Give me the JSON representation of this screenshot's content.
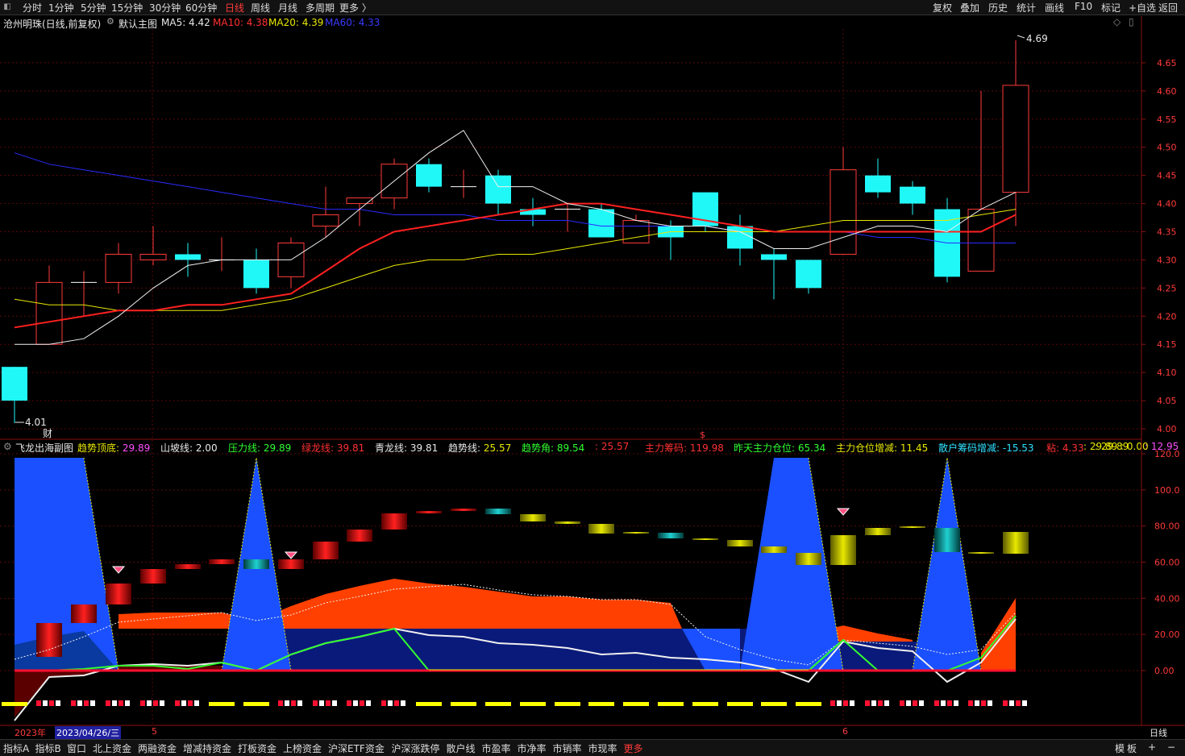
{
  "topbar": {
    "timeframes": [
      "分时",
      "1分钟",
      "5分钟",
      "15分钟",
      "30分钟",
      "60分钟",
      "日线",
      "周线",
      "月线",
      "多周期",
      "更多 〉"
    ],
    "active_timeframe": "日线",
    "tools": [
      "复权",
      "叠加",
      "历史",
      "统计",
      "画线",
      "F10",
      "标记",
      "+自选",
      "返回"
    ]
  },
  "main_chart": {
    "stock": "沧州明珠(日线,前复权)",
    "template": "默认主图",
    "ma_labels": [
      {
        "text": "MA5: 4.42",
        "color": "#e8e8e8"
      },
      {
        "text": "MA10: 4.38",
        "color": "#ff3030"
      },
      {
        "text": "MA20: 4.39",
        "color": "#e8e800"
      },
      {
        "text": "MA60: 4.33",
        "color": "#3a3aff"
      }
    ],
    "y_axis": [
      "4.65",
      "4.60",
      "4.55",
      "4.50",
      "4.45",
      "4.40",
      "4.35",
      "4.30",
      "4.25",
      "4.20",
      "4.15",
      "4.10",
      "4.05",
      "4.00"
    ],
    "high_label": "4.69",
    "low_label": "4.01",
    "marker_cai": "财",
    "marker_s": "$"
  },
  "chart_data": {
    "type": "candlestick",
    "ylim": [
      3.98,
      4.71
    ],
    "candles": [
      {
        "o": 4.11,
        "h": 4.11,
        "l": 4.01,
        "c": 4.05
      },
      {
        "o": 4.15,
        "h": 4.29,
        "l": 4.15,
        "c": 4.26
      },
      {
        "o": 4.26,
        "h": 4.28,
        "l": 4.2,
        "c": 4.26
      },
      {
        "o": 4.26,
        "h": 4.33,
        "l": 4.24,
        "c": 4.31
      },
      {
        "o": 4.3,
        "h": 4.36,
        "l": 4.29,
        "c": 4.31
      },
      {
        "o": 4.31,
        "h": 4.33,
        "l": 4.27,
        "c": 4.3
      },
      {
        "o": 4.3,
        "h": 4.34,
        "l": 4.28,
        "c": 4.3
      },
      {
        "o": 4.3,
        "h": 4.32,
        "l": 4.24,
        "c": 4.25
      },
      {
        "o": 4.27,
        "h": 4.34,
        "l": 4.25,
        "c": 4.33
      },
      {
        "o": 4.36,
        "h": 4.43,
        "l": 4.34,
        "c": 4.38
      },
      {
        "o": 4.4,
        "h": 4.41,
        "l": 4.36,
        "c": 4.41
      },
      {
        "o": 4.41,
        "h": 4.48,
        "l": 4.39,
        "c": 4.47
      },
      {
        "o": 4.47,
        "h": 4.48,
        "l": 4.42,
        "c": 4.43
      },
      {
        "o": 4.43,
        "h": 4.46,
        "l": 4.41,
        "c": 4.43
      },
      {
        "o": 4.45,
        "h": 4.46,
        "l": 4.38,
        "c": 4.4
      },
      {
        "o": 4.39,
        "h": 4.41,
        "l": 4.36,
        "c": 4.38
      },
      {
        "o": 4.39,
        "h": 4.4,
        "l": 4.35,
        "c": 4.39
      },
      {
        "o": 4.39,
        "h": 4.4,
        "l": 4.34,
        "c": 4.34
      },
      {
        "o": 4.33,
        "h": 4.38,
        "l": 4.33,
        "c": 4.37
      },
      {
        "o": 4.36,
        "h": 4.37,
        "l": 4.3,
        "c": 4.34
      },
      {
        "o": 4.42,
        "h": 4.42,
        "l": 4.35,
        "c": 4.36
      },
      {
        "o": 4.36,
        "h": 4.38,
        "l": 4.29,
        "c": 4.32
      },
      {
        "o": 4.31,
        "h": 4.32,
        "l": 4.23,
        "c": 4.3
      },
      {
        "o": 4.3,
        "h": 4.3,
        "l": 4.24,
        "c": 4.25
      },
      {
        "o": 4.31,
        "h": 4.5,
        "l": 4.31,
        "c": 4.46
      },
      {
        "o": 4.45,
        "h": 4.48,
        "l": 4.41,
        "c": 4.42
      },
      {
        "o": 4.43,
        "h": 4.44,
        "l": 4.38,
        "c": 4.4
      },
      {
        "o": 4.39,
        "h": 4.41,
        "l": 4.26,
        "c": 4.27
      },
      {
        "o": 4.28,
        "h": 4.6,
        "l": 4.28,
        "c": 4.39
      },
      {
        "o": 4.42,
        "h": 4.69,
        "l": 4.36,
        "c": 4.61
      }
    ],
    "ma5": [
      4.15,
      4.15,
      4.16,
      4.2,
      4.25,
      4.29,
      4.3,
      4.3,
      4.3,
      4.34,
      4.39,
      4.44,
      4.49,
      4.53,
      4.43,
      4.43,
      4.4,
      4.39,
      4.37,
      4.36,
      4.36,
      4.35,
      4.32,
      4.32,
      4.34,
      4.36,
      4.36,
      4.35,
      4.39,
      4.42
    ],
    "ma10": [
      4.18,
      4.19,
      4.2,
      4.21,
      4.21,
      4.22,
      4.22,
      4.23,
      4.24,
      4.28,
      4.32,
      4.35,
      4.36,
      4.37,
      4.38,
      4.39,
      4.4,
      4.4,
      4.39,
      4.38,
      4.37,
      4.36,
      4.35,
      4.35,
      4.35,
      4.35,
      4.35,
      4.35,
      4.35,
      4.38
    ],
    "ma20": [
      4.23,
      4.22,
      4.22,
      4.21,
      4.21,
      4.21,
      4.21,
      4.22,
      4.23,
      4.25,
      4.27,
      4.29,
      4.3,
      4.3,
      4.31,
      4.31,
      4.32,
      4.33,
      4.34,
      4.35,
      4.35,
      4.35,
      4.35,
      4.36,
      4.37,
      4.37,
      4.37,
      4.37,
      4.38,
      4.39
    ],
    "ma60": [
      4.49,
      4.47,
      4.46,
      4.45,
      4.44,
      4.43,
      4.42,
      4.41,
      4.4,
      4.39,
      4.39,
      4.38,
      4.38,
      4.38,
      4.37,
      4.37,
      4.37,
      4.36,
      4.36,
      4.36,
      4.36,
      4.35,
      4.35,
      4.35,
      4.35,
      4.34,
      4.34,
      4.33,
      4.33,
      4.33
    ]
  },
  "sub_chart": {
    "name": "飞龙出海副图",
    "indicators": [
      {
        "label": "趋势顶底: ",
        "value": "29.89",
        "lcolor": "#e8e800",
        "vcolor": "#ff50ff"
      },
      {
        "label": "山坡线: ",
        "value": "2.00",
        "lcolor": "#e8e8e8",
        "vcolor": "#e8e8e8"
      },
      {
        "label": "压力线: ",
        "value": "29.89",
        "lcolor": "#30ff30",
        "vcolor": "#30ff30"
      },
      {
        "label": "绿龙线: ",
        "value": "39.81",
        "lcolor": "#ff3030",
        "vcolor": "#ff3030"
      },
      {
        "label": "青龙线: ",
        "value": "39.81",
        "lcolor": "#e8e8e8",
        "vcolor": "#e8e8e8"
      },
      {
        "label": "趋势线: ",
        "value": "25.57",
        "lcolor": "#e8e8e8",
        "vcolor": "#e8e800"
      },
      {
        "label": "趋势角: ",
        "value": "89.54",
        "lcolor": "#30ff30",
        "vcolor": "#30ff30"
      },
      {
        "label": " : ",
        "value": "25.57",
        "lcolor": "#ff3030",
        "vcolor": "#ff3030"
      },
      {
        "label": "主力筹码: ",
        "value": "119.98",
        "lcolor": "#ff3030",
        "vcolor": "#ff3030"
      },
      {
        "label": "昨天主力仓位: ",
        "value": "65.34",
        "lcolor": "#30ff30",
        "vcolor": "#30ff30"
      },
      {
        "label": "主力仓位增减: ",
        "value": "11.45",
        "lcolor": "#e8e800",
        "vcolor": "#e8e800"
      },
      {
        "label": "散户筹码增减: ",
        "value": "-15.53",
        "lcolor": "#30e0ff",
        "vcolor": "#30e0ff"
      },
      {
        "label": "粘: ",
        "value": "4.33",
        "lcolor": "#ff3030",
        "vcolor": "#ff3030"
      },
      {
        "label": " : ",
        "value": "29.89",
        "lcolor": "#e8e800",
        "vcolor": "#e8e800"
      },
      {
        "label": " : ",
        "value": "12.95",
        "lcolor": "#ff50ff",
        "vcolor": "#ff50ff"
      }
    ],
    "extra_right": ": 29.89 : 0.00",
    "y_axis": [
      "120.0",
      "100.0",
      "80.00",
      "60.00",
      "40.00",
      "20.00",
      "0.00"
    ]
  },
  "date_bar": {
    "year": "2023年",
    "date": "2023/04/26/三",
    "m5": "5",
    "m6": "6"
  },
  "bottombar": {
    "tabs": [
      "指标A",
      "指标B",
      "窗口",
      "北上资金",
      "两融资金",
      "增减持资金",
      "打板资金",
      "上榜资金",
      "沪深ETF资金",
      "沪深涨跌停",
      "散户线",
      "市盈率",
      "市净率",
      "市销率",
      "市现率",
      "更多"
    ],
    "right": [
      "模",
      "板",
      "+",
      "−"
    ],
    "period_label": "日线"
  }
}
